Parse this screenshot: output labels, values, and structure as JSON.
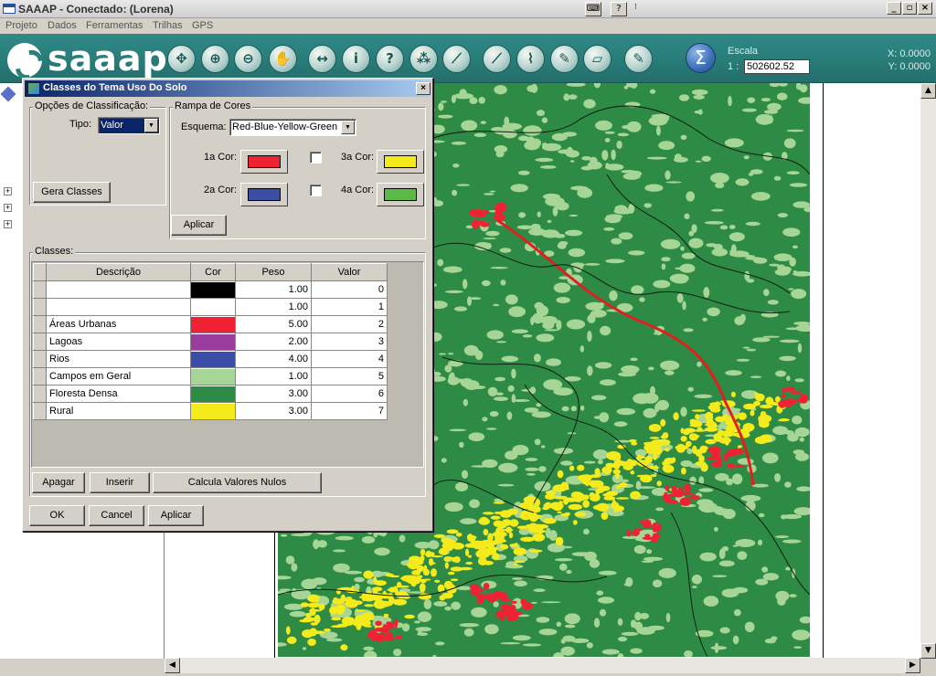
{
  "window": {
    "title": "SAAAP - Conectado:  (Lorena)"
  },
  "menu": [
    "Projeto",
    "Dados",
    "Ferramentas",
    "Trilhas",
    "GPS"
  ],
  "toolbar": {
    "logo": "saaap",
    "tools": [
      {
        "name": "pan-all-icon",
        "glyph": "✥"
      },
      {
        "name": "zoom-in-icon",
        "glyph": "⊕"
      },
      {
        "name": "zoom-out-icon",
        "glyph": "⊖"
      },
      {
        "name": "hand-icon",
        "glyph": "✋"
      },
      {
        "name": "measure-icon",
        "glyph": "↔"
      },
      {
        "name": "info-icon",
        "glyph": "i"
      },
      {
        "name": "help-icon",
        "glyph": "?"
      },
      {
        "name": "select-icon",
        "glyph": "⁂"
      },
      {
        "name": "chart-icon",
        "glyph": "⟋"
      },
      {
        "name": "line-icon",
        "glyph": "⟋"
      },
      {
        "name": "polyline-icon",
        "glyph": "⌇"
      },
      {
        "name": "pencil-icon",
        "glyph": "✎"
      },
      {
        "name": "eraser-icon",
        "glyph": "▱"
      },
      {
        "name": "pen-icon",
        "glyph": "✎"
      }
    ],
    "sigma": "Σ",
    "escala_label": "Escala",
    "escala_prefix": "1 :",
    "escala_value": "502602.52",
    "x_coord": "X: 0.0000",
    "y_coord": "Y: 0.0000"
  },
  "dialog": {
    "title": "Classes do Tema Uso Do Solo",
    "classification_group": "Opções de Classificação:",
    "tipo_label": "Tipo:",
    "tipo_value": "Valor",
    "gera_classes": "Gera Classes",
    "ramp_group": "Rampa de Cores",
    "esquema_label": "Esquema:",
    "esquema_value": "Red-Blue-Yellow-Green",
    "color1_label": "1a Cor:",
    "color2_label": "2a Cor:",
    "color3_label": "3a Cor:",
    "color4_label": "4a Cor:",
    "color1": "#ee2233",
    "color2": "#3a4ea8",
    "color3": "#f4ea1c",
    "color4": "#5cb947",
    "aplicar_ramp": "Aplicar",
    "classes_group": "Classes:",
    "columns": [
      "Descrição",
      "Cor",
      "Peso",
      "Valor"
    ],
    "rows": [
      {
        "descricao": "",
        "cor": "#000000",
        "peso": "1.00",
        "valor": "0"
      },
      {
        "descricao": "",
        "cor": "#ffffff",
        "peso": "1.00",
        "valor": "1"
      },
      {
        "descricao": "Áreas Urbanas",
        "cor": "#ee2233",
        "peso": "5.00",
        "valor": "2"
      },
      {
        "descricao": "Lagoas",
        "cor": "#9b3d9e",
        "peso": "2.00",
        "valor": "3"
      },
      {
        "descricao": "Rios",
        "cor": "#3a4ea8",
        "peso": "4.00",
        "valor": "4"
      },
      {
        "descricao": "Campos em Geral",
        "cor": "#a6d596",
        "peso": "1.00",
        "valor": "5"
      },
      {
        "descricao": "Floresta Densa",
        "cor": "#2e8b45",
        "peso": "3.00",
        "valor": "6"
      },
      {
        "descricao": "Rural",
        "cor": "#f4ea1c",
        "peso": "3.00",
        "valor": "7"
      }
    ],
    "apagar": "Apagar",
    "inserir": "Inserir",
    "calcula": "Calcula Valores Nulos",
    "ok": "OK",
    "cancel": "Cancel",
    "aplicar": "Aplicar"
  },
  "map": {
    "forest": "#2e8b45",
    "fields": "#a6d596",
    "urban": "#ee2233",
    "rural": "#f4ea1c",
    "road": "#e02020"
  }
}
